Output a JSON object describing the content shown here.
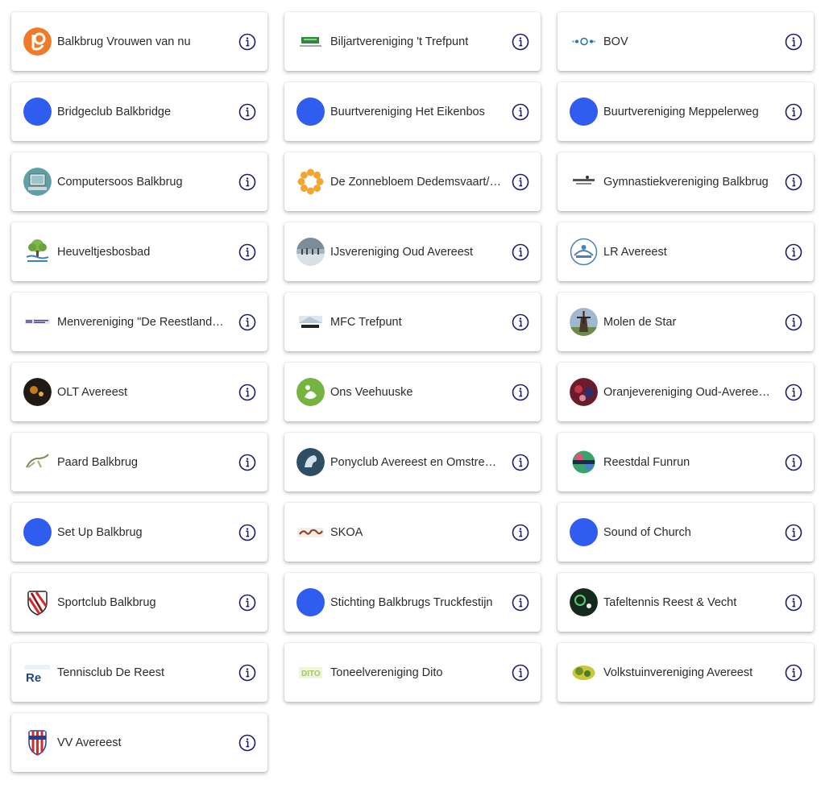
{
  "accent_color": "#1c1c6c",
  "placeholder_logo_color": "#2f5df0",
  "clubs": [
    {
      "name": "Balkbrug Vrouwen van nu",
      "logo": "orange-vvn-logo"
    },
    {
      "name": "Biljartvereniging 't Trefpunt",
      "logo": "green-banner-logo"
    },
    {
      "name": "BOV",
      "logo": "bov-logo"
    },
    {
      "name": "Bridgeclub Balkbridge",
      "logo": "placeholder-dot"
    },
    {
      "name": "Buurtvereniging Het Eikenbos",
      "logo": "placeholder-dot"
    },
    {
      "name": "Buurtvereniging Meppelerweg",
      "logo": "placeholder-dot"
    },
    {
      "name": "Computersoos Balkbrug",
      "logo": "computer-logo"
    },
    {
      "name": "De Zonnebloem Dedemsvaart/…",
      "logo": "sunflower-logo"
    },
    {
      "name": "Gymnastiekvereniging Balkbrug",
      "logo": "gym-logo"
    },
    {
      "name": "Heuveltjesbosbad",
      "logo": "tree-logo"
    },
    {
      "name": "IJsvereniging Oud Avereest",
      "logo": "ice-photo-logo"
    },
    {
      "name": "LR Avereest",
      "logo": "lr-logo"
    },
    {
      "name": "Menvereniging \"De Reestlandk…",
      "logo": "menvereniging-logo"
    },
    {
      "name": "MFC Trefpunt",
      "logo": "mfc-logo"
    },
    {
      "name": "Molen de Star",
      "logo": "windmill-photo-logo"
    },
    {
      "name": "OLT Avereest",
      "logo": "olt-photo-logo"
    },
    {
      "name": "Ons Veehuuske",
      "logo": "veehuuske-logo"
    },
    {
      "name": "Oranjevereniging Oud-Averees…",
      "logo": "oranje-photo-logo"
    },
    {
      "name": "Paard Balkbrug",
      "logo": "horse-logo"
    },
    {
      "name": "Ponyclub Avereest en Omstreken",
      "logo": "ponyclub-logo"
    },
    {
      "name": "Reestdal Funrun",
      "logo": "funrun-logo"
    },
    {
      "name": "Set Up Balkbrug",
      "logo": "placeholder-dot"
    },
    {
      "name": "SKOA",
      "logo": "skoa-logo"
    },
    {
      "name": "Sound of Church",
      "logo": "placeholder-dot"
    },
    {
      "name": "Sportclub Balkbrug",
      "logo": "shield-logo"
    },
    {
      "name": "Stichting Balkbrugs Truckfestijn",
      "logo": "placeholder-dot"
    },
    {
      "name": "Tafeltennis Reest & Vecht",
      "logo": "tafeltennis-logo"
    },
    {
      "name": "Tennisclub De Reest",
      "logo": "tennis-logo"
    },
    {
      "name": "Toneelvereniging Dito",
      "logo": "dito-logo"
    },
    {
      "name": "Volkstuinvereniging Avereest",
      "logo": "volkstuin-logo"
    },
    {
      "name": "VV Avereest",
      "logo": "vv-shield-logo"
    }
  ],
  "info_icon": "info-circle-icon"
}
